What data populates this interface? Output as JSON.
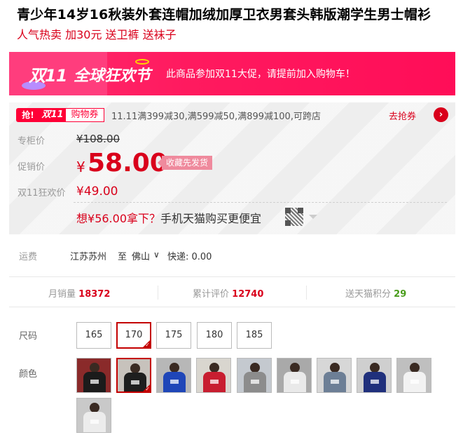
{
  "product": {
    "title": "青少年14岁16秋装外套连帽加绒加厚卫衣男套头韩版潮学生男士帽衫",
    "subtitle": "人气热卖 加30元 送卫裤 送袜子"
  },
  "banner": {
    "logo_11": "双11",
    "logo_main": "全球狂欢节",
    "promo_text": "此商品参加双11大促，请提前加入购物车！"
  },
  "coupon": {
    "tag_qiang": "抢!",
    "tag_11": "双11",
    "tag_coupon": "购物券",
    "text": "11.11满399减30,满599减50,满899减100,可跨店",
    "grab_link": "去抢券",
    "arrow": "›"
  },
  "price": {
    "counter_label": "专柜价",
    "counter_price": "¥108.00",
    "sale_label": "促销价",
    "sale_yen": "¥",
    "sale_price": "58.00",
    "fav_badge": "收藏先发货",
    "d11_label": "双11狂欢价",
    "d11_price": "¥49.00"
  },
  "mobile": {
    "prefix": "想",
    "price": "¥56.00",
    "middle": "拿下？",
    "suffix": "手机天猫购买更便宜"
  },
  "shipping": {
    "label": "运费",
    "from": "江苏苏州",
    "to": "至",
    "dest": "佛山",
    "caret": "∨",
    "express": "快递: 0.00"
  },
  "stats": {
    "monthly_sales_label": "月销量",
    "monthly_sales": "18372",
    "reviews_label": "累计评价",
    "reviews": "12740",
    "points_label": "送天猫积分",
    "points": "29"
  },
  "size": {
    "label": "尺码",
    "options": [
      "165",
      "170",
      "175",
      "180",
      "185"
    ],
    "selected_index": 1
  },
  "color": {
    "label": "颜色",
    "swatches": [
      {
        "name": "black-red",
        "body": "#1b1b1b",
        "bg": "#8a2a2a"
      },
      {
        "name": "black-selected",
        "body": "#1e1e1e",
        "bg": "#c7c2bc"
      },
      {
        "name": "blue",
        "body": "#1f46b8",
        "bg": "#b7b7b7"
      },
      {
        "name": "red",
        "body": "#c81e30",
        "bg": "#d9d6cf"
      },
      {
        "name": "gray",
        "body": "#8c8c8c",
        "bg": "#c4c9cf"
      },
      {
        "name": "white-black",
        "body": "#e9e9e9",
        "bg": "#a9a9a9"
      },
      {
        "name": "gray-blue",
        "body": "#6d7f96",
        "bg": "#d7d7d7"
      },
      {
        "name": "navy-blue",
        "body": "#20307c",
        "bg": "#cfcfcf"
      },
      {
        "name": "white-blue",
        "body": "#f2f2f2",
        "bg": "#bfbfbf"
      },
      {
        "name": "white-gray",
        "body": "#ececec",
        "bg": "#c9c9c9"
      }
    ],
    "selected_index": 1
  },
  "colors": {
    "accent_red": "#d9001b",
    "banner_pink": "#ff1a5f",
    "points_green": "#4a9d1c"
  }
}
